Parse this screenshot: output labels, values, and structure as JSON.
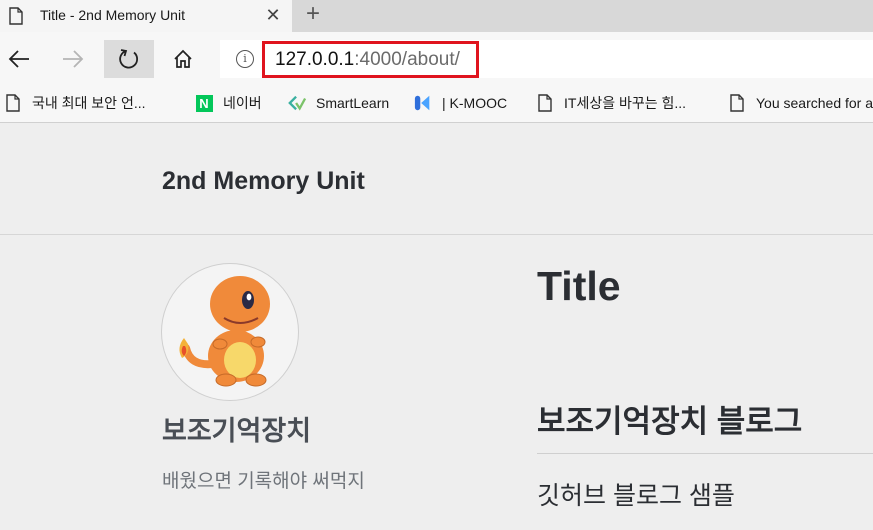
{
  "browser": {
    "tab": {
      "title": "Title - 2nd Memory Unit",
      "close_glyph": "✕"
    },
    "new_tab_glyph": "+",
    "address": {
      "host": "127.0.0.1",
      "rest": ":4000/about/"
    },
    "favorites": [
      {
        "label": "국내 최대 보안 언...",
        "icon": "document-icon"
      },
      {
        "label": "네이버",
        "icon": "naver-icon",
        "icon_text": "N",
        "icon_color": "#03c75a"
      },
      {
        "label": "SmartLearn",
        "icon": "smartlearn-icon",
        "icon_color": "#3ab0a0"
      },
      {
        "label": "| K-MOOC",
        "icon": "kmooc-icon",
        "icon_color": "#2f6fdb"
      },
      {
        "label": "IT세상을 바꾸는 힘...",
        "icon": "document-icon"
      },
      {
        "label": "You searched for a",
        "icon": "document-icon"
      }
    ],
    "highlight_color": "#e0141e"
  },
  "site": {
    "title": "2nd Memory Unit",
    "author_name": "보조기억장치",
    "author_bio": "배웠으면 기록해야 써먹지",
    "page_title": "Title",
    "section_heading": "보조기억장치 블로그",
    "body_text": "깃허브 블로그 샘플",
    "avatar_icon": "charmander-avatar"
  }
}
